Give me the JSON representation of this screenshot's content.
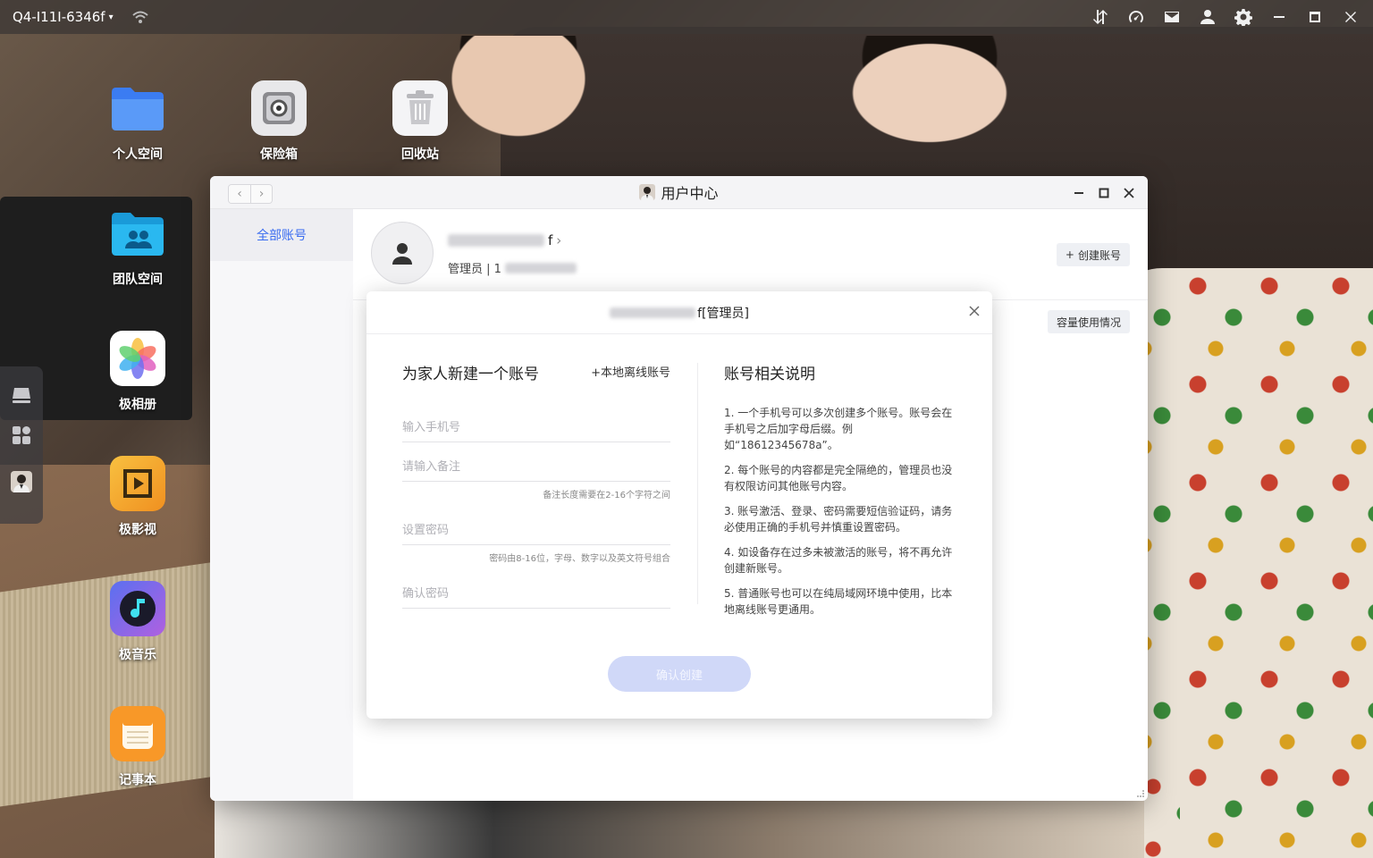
{
  "topbar": {
    "device_name": "Q4-I11I-6346f",
    "icons": [
      "wifi-icon",
      "transfer-icon",
      "speedometer-icon",
      "mail-icon",
      "user-icon",
      "settings-icon",
      "minimize-icon",
      "maximize-icon",
      "close-icon"
    ]
  },
  "desktop": {
    "icons": [
      {
        "label": "个人空间",
        "icon": "folder-icon"
      },
      {
        "label": "保险箱",
        "icon": "safe-icon"
      },
      {
        "label": "回收站",
        "icon": "trash-icon"
      },
      {
        "label": "团队空间",
        "icon": "team-folder-icon"
      },
      {
        "label": "极相册",
        "icon": "photos-icon"
      },
      {
        "label": "极影视",
        "icon": "video-icon"
      },
      {
        "label": "极音乐",
        "icon": "music-icon"
      },
      {
        "label": "记事本",
        "icon": "notes-icon"
      }
    ]
  },
  "window": {
    "title": "用户中心",
    "sidebar": {
      "items": [
        {
          "label": "全部账号"
        }
      ]
    },
    "user": {
      "name_suffix": "f",
      "role_label": "管理员 | 1"
    },
    "create_button": "创建账号",
    "capacity_button": "容量使用情况"
  },
  "dialog": {
    "title_suffix": "f[管理员]",
    "form_title": "为家人新建一个账号",
    "local_link": "+本地离线账号",
    "phone_placeholder": "输入手机号",
    "note_placeholder": "请输入备注",
    "note_hint": "备注长度需要在2-16个字符之间",
    "password_placeholder": "设置密码",
    "password_hint": "密码由8-16位，字母、数字以及英文符号组合",
    "confirm_placeholder": "确认密码",
    "info_title": "账号相关说明",
    "info_items": [
      "1. 一个手机号可以多次创建多个账号。账号会在手机号之后加字母后缀。例如“18612345678a”。",
      "2. 每个账号的内容都是完全隔绝的，管理员也没有权限访问其他账号内容。",
      "3. 账号激活、登录、密码需要短信验证码，请务必使用正确的手机号并慎重设置密码。",
      "4. 如设备存在过多未被激活的账号，将不再允许创建新账号。",
      "5. 普通账号也可以在纯局域网环境中使用，比本地离线账号更通用。"
    ],
    "confirm_button": "确认创建"
  },
  "colors": {
    "accent": "#3a6cf0",
    "confirm_disabled": "#d0d8f8"
  }
}
